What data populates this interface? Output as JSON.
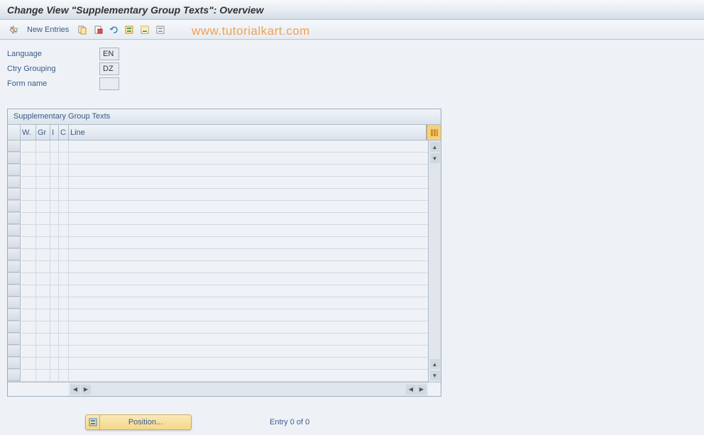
{
  "title": "Change View \"Supplementary Group Texts\": Overview",
  "toolbar": {
    "new_entries": "New Entries"
  },
  "watermark": "www.tutorialkart.com",
  "form": {
    "language_label": "Language",
    "language_value": "EN",
    "ctry_label": "Ctry Grouping",
    "ctry_value": "DZ",
    "formname_label": "Form name",
    "formname_value": ""
  },
  "table": {
    "title": "Supplementary Group Texts",
    "col_w": "W.",
    "col_gr": "Gr",
    "col_i": "I",
    "col_c": "C",
    "col_line": "Line"
  },
  "footer": {
    "position_label": "Position...",
    "entry_status": "Entry 0 of 0"
  }
}
